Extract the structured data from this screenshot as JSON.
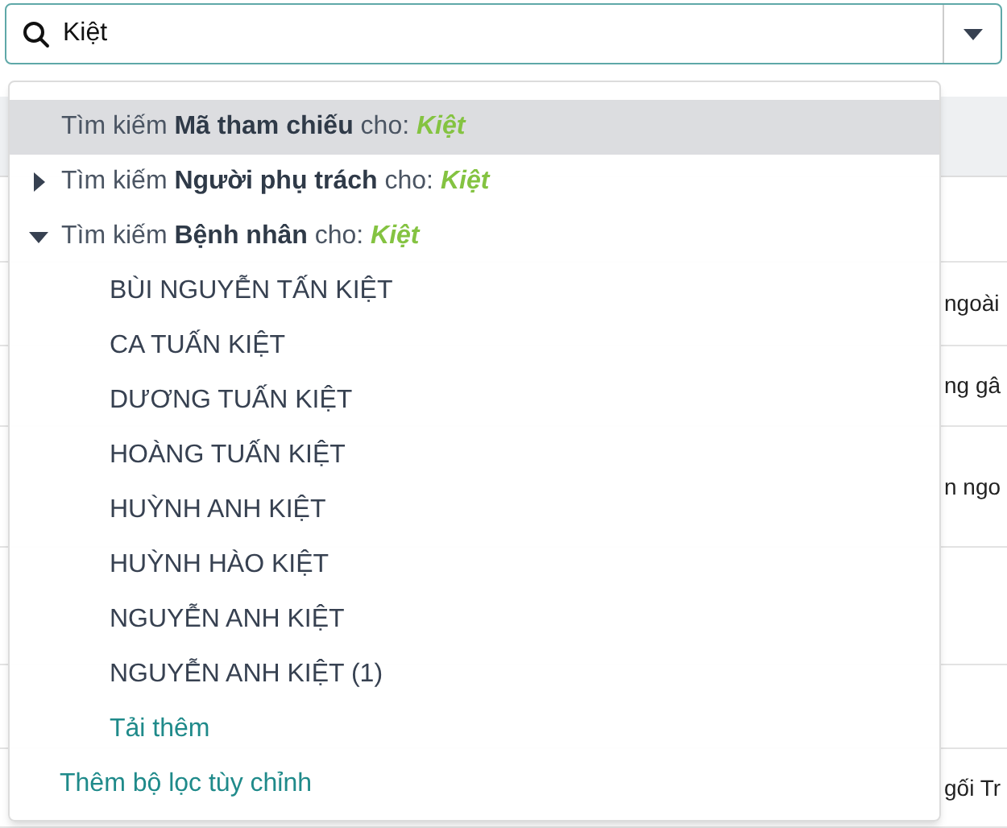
{
  "search": {
    "value": "Kiệt"
  },
  "suggestions": [
    {
      "kind": "field",
      "selected": true,
      "label": "Tìm kiếm **Mã tham chiếu** cho: ",
      "term": "Kiệt"
    },
    {
      "kind": "relation",
      "selected": false,
      "expanded": false,
      "label": "Tìm kiếm **Người phụ trách** cho: ",
      "term": "Kiệt"
    },
    {
      "kind": "relation",
      "selected": false,
      "expanded": true,
      "label": "Tìm kiếm **Bệnh nhân** cho: ",
      "term": "Kiệt",
      "children": [
        {
          "kind": "record",
          "label": "BÙI NGUYỄN TẤN KIỆT"
        },
        {
          "kind": "record",
          "label": "CA TUẤN KIỆT"
        },
        {
          "kind": "record",
          "label": "DƯƠNG TUẤN KIỆT"
        },
        {
          "kind": "record",
          "label": "HOÀNG TUẤN KIỆT"
        },
        {
          "kind": "record",
          "label": "HUỲNH ANH KIỆT"
        },
        {
          "kind": "record",
          "label": "HUỲNH HÀO KIỆT"
        },
        {
          "kind": "record",
          "label": "NGUYỄN ANH KIỆT"
        },
        {
          "kind": "record",
          "label": "NGUYỄN ANH KIỆT (1)"
        },
        {
          "kind": "more",
          "label": "Tải thêm"
        }
      ]
    }
  ],
  "custom_filter": "Thêm bộ lọc tùy chỉnh",
  "background_rows": [
    {
      "kind": "empty"
    },
    {
      "kind": "text",
      "column_1": "ngoài"
    },
    {
      "kind": "text",
      "column_1": "ng gâ"
    },
    {
      "kind": "text",
      "column_1": "n ngo"
    },
    {
      "kind": "empty"
    },
    {
      "kind": "empty"
    },
    {
      "kind": "text",
      "column_1": "gối Tr"
    }
  ]
}
